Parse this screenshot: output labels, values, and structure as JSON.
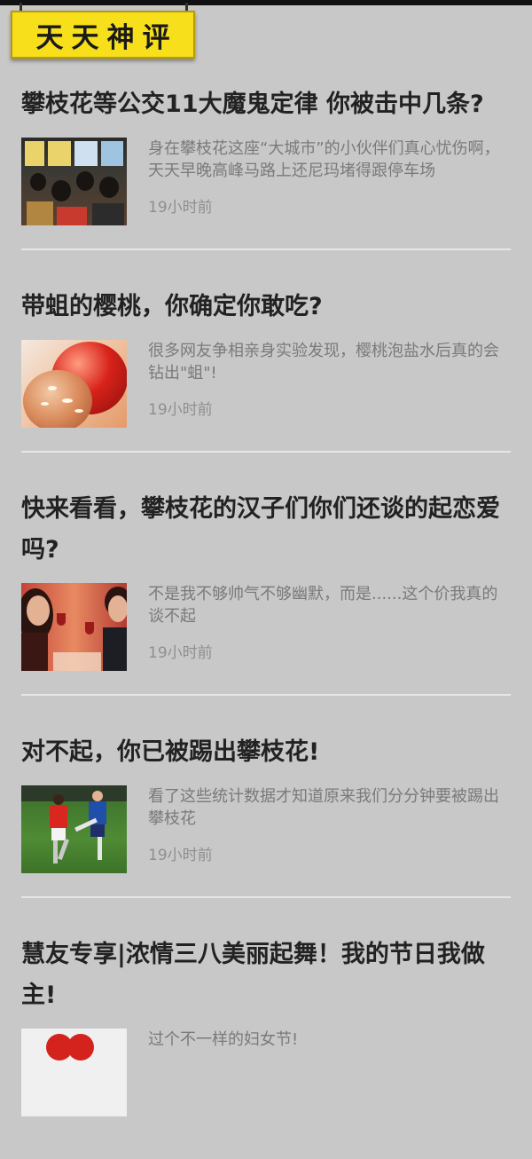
{
  "banner": {
    "title": "天天神评"
  },
  "articles": [
    {
      "title": "攀枝花等公交11大魔鬼定律 你被击中几条?",
      "summary": "身在攀枝花这座“大城市”的小伙伴们真心忧伤啊，天天早晚高峰马路上还尼玛堵得跟停车场",
      "time": "19小时前",
      "thumb_icon": "crowded-bus-photo"
    },
    {
      "title": "带蛆的樱桃，你确定你敢吃?",
      "summary": "很多网友争相亲身实验发现，樱桃泡盐水后真的会钻出\"蛆\"!",
      "time": "19小时前",
      "thumb_icon": "cherry-photo"
    },
    {
      "title": "快来看看，攀枝花的汉子们你们还谈的起恋爱吗?",
      "summary": "不是我不够帅气不够幽默，而是......这个价我真的谈不起",
      "time": "19小时前",
      "thumb_icon": "couple-dinner-photo"
    },
    {
      "title": "对不起，你已被踢出攀枝花!",
      "summary": "看了这些统计数据才知道原来我们分分钟要被踢出攀枝花",
      "time": "19小时前",
      "thumb_icon": "soccer-photo"
    },
    {
      "title": "慧友专享|浓情三八美丽起舞！我的节日我做主!",
      "summary": "过个不一样的妇女节!",
      "time": "",
      "thumb_icon": "heart-photo"
    }
  ]
}
